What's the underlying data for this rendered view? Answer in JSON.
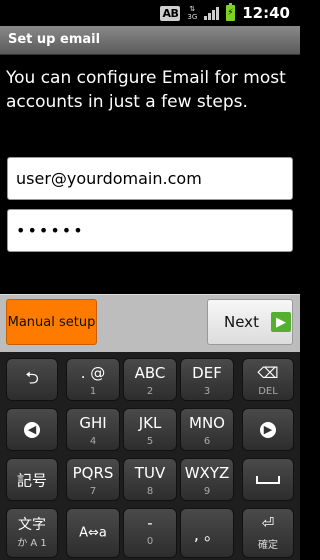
{
  "status_bar": {
    "ime_label": "AB",
    "network_label_top": "⇅",
    "network_label_bottom": "3G",
    "signal_strength": 4,
    "battery_level": 1.0,
    "time": "12:40"
  },
  "title_bar": {
    "title": "Set up email"
  },
  "intro_text": "You can configure Email for most accounts in just a few steps.",
  "form": {
    "email_value": "user@yourdomain.com",
    "password_value": "••••••"
  },
  "buttons": {
    "manual_setup": "Manual setup",
    "next": "Next",
    "next_icon": "▶"
  },
  "keyboard": {
    "row1": [
      {
        "name": "back-arrow-key",
        "main": "⮌",
        "sub": ""
      },
      {
        "name": "key-1",
        "main": ". @",
        "sub": "1"
      },
      {
        "name": "key-2",
        "main": "ABC",
        "sub": "2"
      },
      {
        "name": "key-3",
        "main": "DEF",
        "sub": "3"
      },
      {
        "name": "delete-key",
        "main": "⌫",
        "sub": "DEL"
      }
    ],
    "row2": [
      {
        "name": "left-key",
        "main": "◀",
        "sub": ""
      },
      {
        "name": "key-4",
        "main": "GHI",
        "sub": "4"
      },
      {
        "name": "key-5",
        "main": "JKL",
        "sub": "5"
      },
      {
        "name": "key-6",
        "main": "MNO",
        "sub": "6"
      },
      {
        "name": "right-key",
        "main": "▶",
        "sub": ""
      }
    ],
    "row3": [
      {
        "name": "symbol-key",
        "main": "記号",
        "sub": ""
      },
      {
        "name": "key-7",
        "main": "PQRS",
        "sub": "7"
      },
      {
        "name": "key-8",
        "main": "TUV",
        "sub": "8"
      },
      {
        "name": "key-9",
        "main": "WXYZ",
        "sub": "9"
      },
      {
        "name": "space-key",
        "main": "",
        "sub": ""
      }
    ],
    "row4": [
      {
        "name": "input-mode-key",
        "main": "文字",
        "sub": "か A 1"
      },
      {
        "name": "case-toggle-key",
        "main": "A⇔a",
        "sub": ""
      },
      {
        "name": "key-0",
        "main": "-",
        "sub": "0"
      },
      {
        "name": "punctuation-key",
        "main": ", 。",
        "sub": ""
      },
      {
        "name": "enter-key",
        "main": "⏎",
        "sub": "確定"
      }
    ]
  }
}
